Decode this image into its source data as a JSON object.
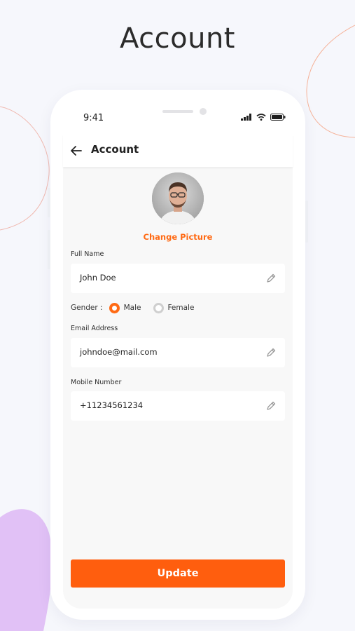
{
  "page": {
    "title": "Account"
  },
  "status_bar": {
    "time": "9:41",
    "icons": [
      "signal-icon",
      "wifi-icon",
      "battery-icon"
    ]
  },
  "header": {
    "title": "Account",
    "back_icon": "arrow-left-icon"
  },
  "profile": {
    "change_picture_label": "Change Picture"
  },
  "form": {
    "full_name": {
      "label": "Full Name",
      "value": "John Doe"
    },
    "gender": {
      "label": "Gender :",
      "options": [
        {
          "label": "Male",
          "selected": true
        },
        {
          "label": "Female",
          "selected": false
        }
      ]
    },
    "email": {
      "label": "Email Address",
      "value": "johndoe@mail.com"
    },
    "mobile": {
      "label": "Mobile Number",
      "value": "+11234561234"
    }
  },
  "actions": {
    "update_label": "Update"
  },
  "colors": {
    "accent": "#ff5e0e",
    "background": "#f6f7fc",
    "blob": "#e1c1f6"
  }
}
